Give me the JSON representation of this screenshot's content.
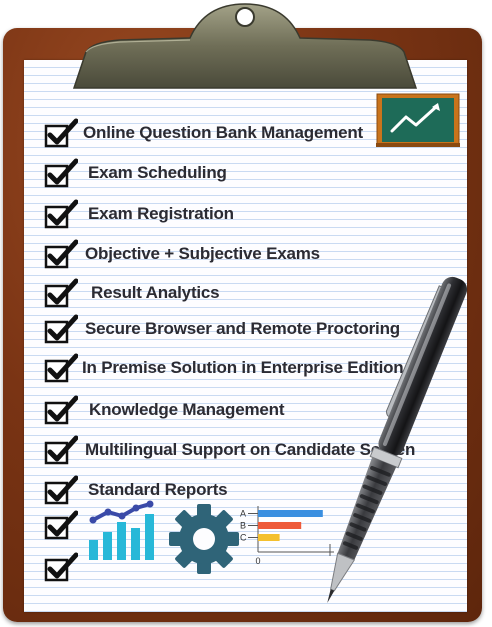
{
  "checklist": {
    "items": [
      {
        "label": "Online Question Bank Management"
      },
      {
        "label": "Exam Scheduling"
      },
      {
        "label": "Exam Registration"
      },
      {
        "label": "Objective + Subjective Exams"
      },
      {
        "label": "Result Analytics"
      },
      {
        "label": "Secure Browser and Remote Proctoring"
      },
      {
        "label": "In Premise Solution in Enterprise Edition"
      },
      {
        "label": "Knowledge Management"
      },
      {
        "label": "Multilingual Support on Candidate Screen"
      },
      {
        "label": "Standard Reports"
      }
    ]
  },
  "mini_chart": {
    "categories": [
      "A",
      "B",
      "C"
    ],
    "values": [
      0.9,
      0.6,
      0.3
    ],
    "axis_zero": "0",
    "colors": [
      "#3a8fe0",
      "#ee5a3a",
      "#f4c02e"
    ]
  },
  "icons": {
    "clipboard": "clipboard-icon",
    "chalkboard": "chalkboard-chart-icon",
    "bars": "bar-chart-icon",
    "gear": "gear-icon",
    "pen": "pen-icon"
  },
  "colors": {
    "board": "#7a3414",
    "paper": "#fdfdff",
    "text": "#2b2b33",
    "check": "#111111",
    "chalkboard": "#1e6b58",
    "chalkboard_frame": "#c9741c",
    "bars": "#27b8d8",
    "gear": "#2f6478"
  }
}
